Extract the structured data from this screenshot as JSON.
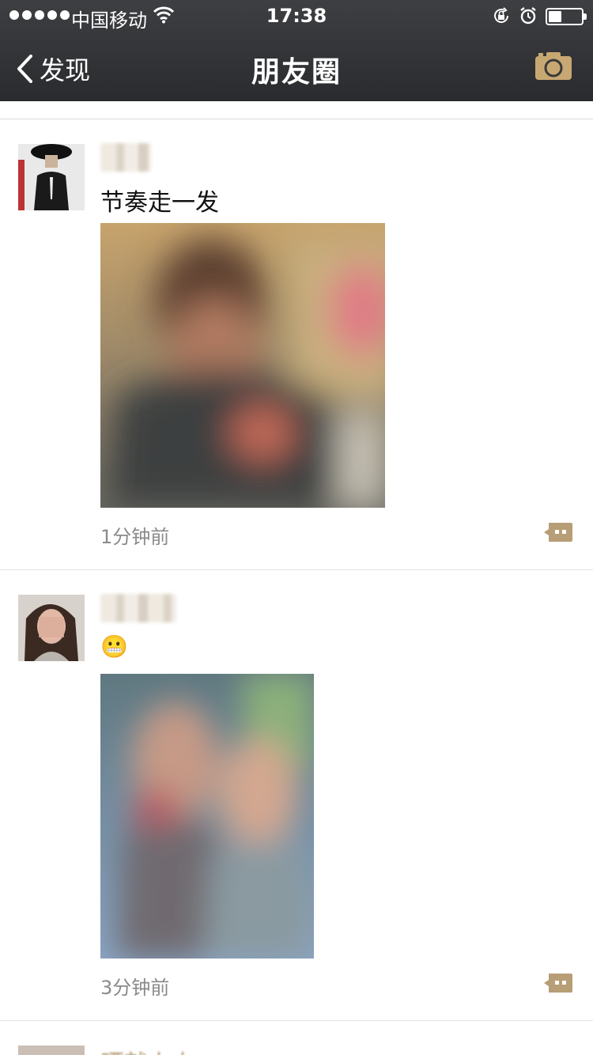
{
  "status": {
    "carrier": "中国移动",
    "time": "17:38",
    "battery_level": 0.4
  },
  "nav": {
    "back_label": "发现",
    "title": "朋友圈"
  },
  "icons": {
    "back": "chevron-left-icon",
    "camera": "camera-icon",
    "comment": "comment-more-icon"
  },
  "colors": {
    "nav_bg": "#2f3033",
    "accent": "#b79e76",
    "timestamp": "#8a8a8a"
  },
  "posts": [
    {
      "text": "节奏走一发",
      "timestamp": "1分钟前"
    },
    {
      "emoji": "😬",
      "timestamp": "3分钟前"
    }
  ],
  "peek_post": {
    "name": "晒就上上"
  }
}
